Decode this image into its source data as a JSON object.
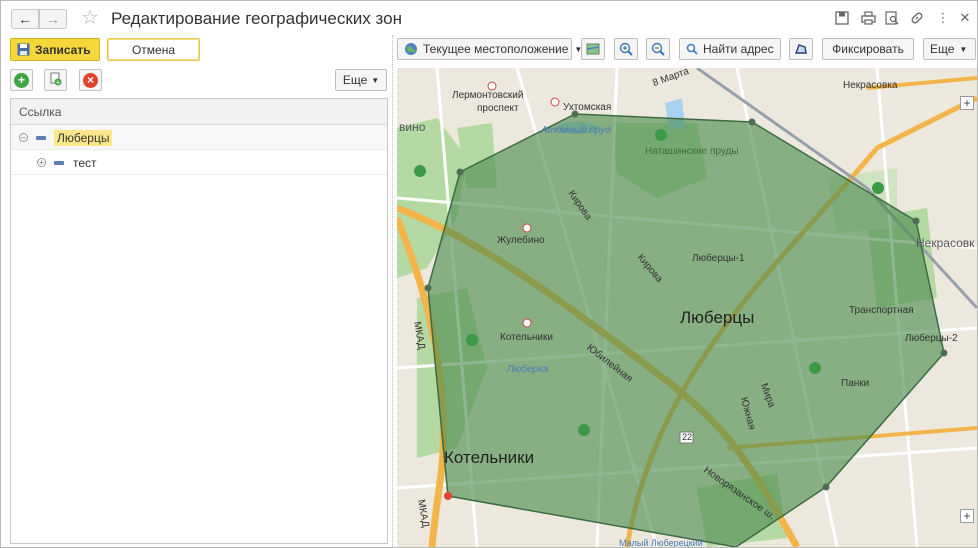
{
  "window": {
    "title": "Редактирование географических зон"
  },
  "toolbar": {
    "save_label": "Записать",
    "cancel_label": "Отмена",
    "more_label": "Еще"
  },
  "tree": {
    "column_header": "Ссылка",
    "items": [
      {
        "label": "Люберцы",
        "expanded": true
      },
      {
        "label": "тест",
        "expanded": false
      }
    ]
  },
  "map_toolbar": {
    "location_label": "Текущее местоположение",
    "find_address_label": "Найти адрес",
    "fix_label": "Фиксировать",
    "more_label": "Еще"
  },
  "map": {
    "labels": {
      "lermontovsky": "Лермонтовский",
      "prospekt": "проспект",
      "ukhtomskaya": "Ухтомская",
      "atomny_prud": "Атомный пруд",
      "natashinskie": "Наташинские пруды",
      "nekrasovka_top": "Некрасовка",
      "nekrasovka_right": "Некрасовк",
      "vino": "вино",
      "kirova_1": "Кирова",
      "kirova_2": "Кирова",
      "zhulebino": "Жулебино",
      "lyubertsy_1": "Люберцы-1",
      "lyubertsy_city": "Люберцы",
      "transportnaya": "Транспортная",
      "lyubertsy_2": "Люберцы-2",
      "kotelniki_station": "Котельники",
      "yubileynaya": "Юбилейная",
      "lyuberka": "Люберка",
      "mira": "Мира",
      "yuzhnaya": "Южная",
      "panki": "Панки",
      "kotelniki_city": "Котельники",
      "mkad_1": "МКАД",
      "mkad_2": "МКАД",
      "road_22": "22",
      "novoryazanskoe": "Новорязанское ш.",
      "street_8": "8 Марта",
      "bottom_text": "Малый Люберецкий"
    },
    "colors": {
      "zone_fill": "#4a8a4d",
      "zone_stroke": "#3d6b44",
      "background": "#ece8de",
      "park": "#b5d9a3",
      "highway": "#f3b54a",
      "water": "#a8d3f0"
    }
  }
}
